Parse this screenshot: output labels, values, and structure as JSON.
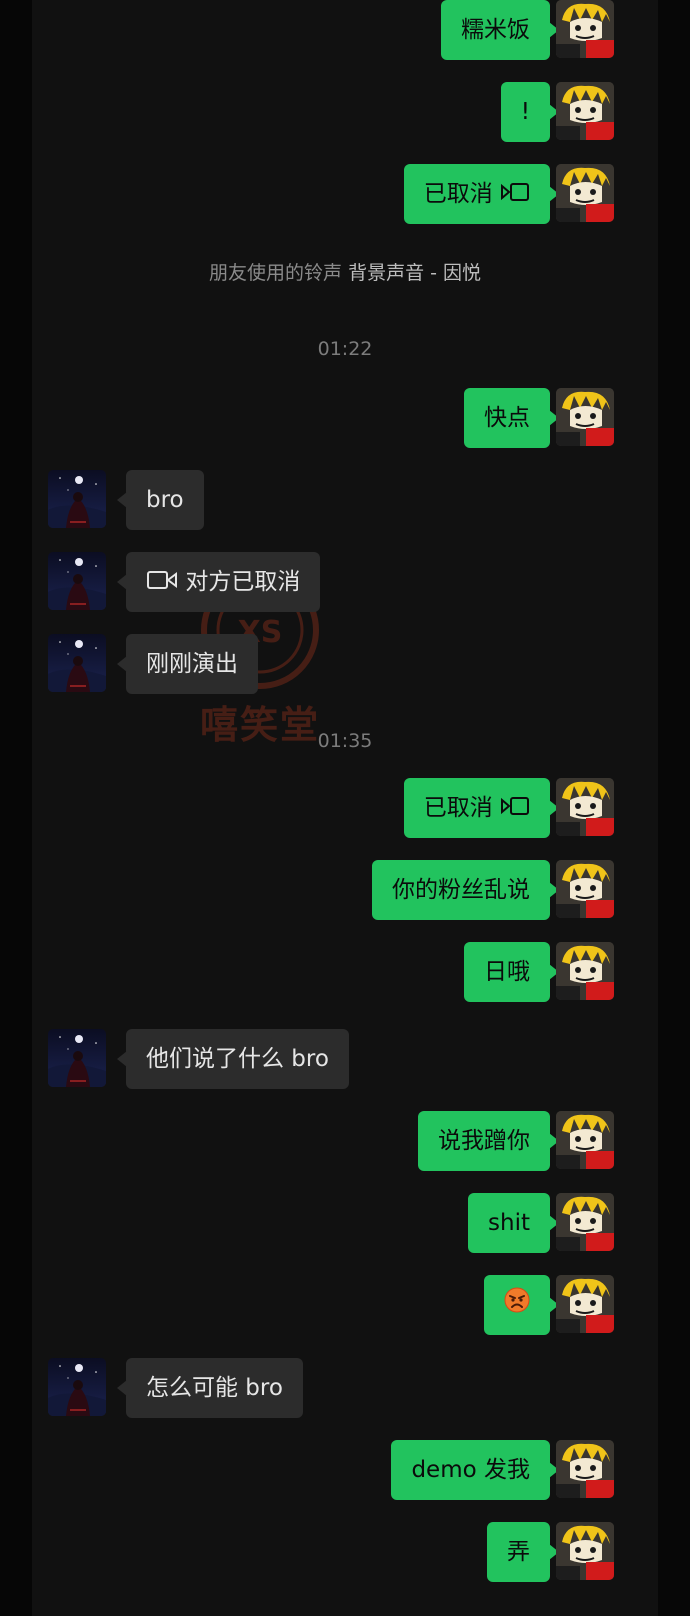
{
  "system_notice": {
    "prefix": "朋友使用的铃声",
    "song": "背景声音 - 因悦"
  },
  "timestamps": [
    "01:22",
    "01:35"
  ],
  "watermark_text": "嘻笑堂",
  "messages": [
    {
      "side": "out",
      "text": "糯米饭"
    },
    {
      "side": "out",
      "text": "!"
    },
    {
      "side": "out",
      "text": "已取消",
      "icon": "video-call-icon"
    },
    {
      "side": "out",
      "text": "快点"
    },
    {
      "side": "in",
      "text": "bro"
    },
    {
      "side": "in",
      "text": "对方已取消",
      "icon": "video-call-icon"
    },
    {
      "side": "in",
      "text": "刚刚演出"
    },
    {
      "side": "out",
      "text": "已取消",
      "icon": "video-call-icon"
    },
    {
      "side": "out",
      "text": "你的粉丝乱说"
    },
    {
      "side": "out",
      "text": "日哦"
    },
    {
      "side": "in",
      "text": "他们说了什么 bro"
    },
    {
      "side": "out",
      "text": "说我蹭你"
    },
    {
      "side": "out",
      "text": "shit"
    },
    {
      "side": "out",
      "text": "",
      "icon": "angry-face-emoji-icon"
    },
    {
      "side": "in",
      "text": "怎么可能 bro"
    },
    {
      "side": "out",
      "text": "demo 发我"
    },
    {
      "side": "out",
      "text": "弄"
    }
  ],
  "colors": {
    "outgoing_bubble": "#22c35e",
    "incoming_bubble": "#2c2c2c",
    "background": "#111111"
  }
}
